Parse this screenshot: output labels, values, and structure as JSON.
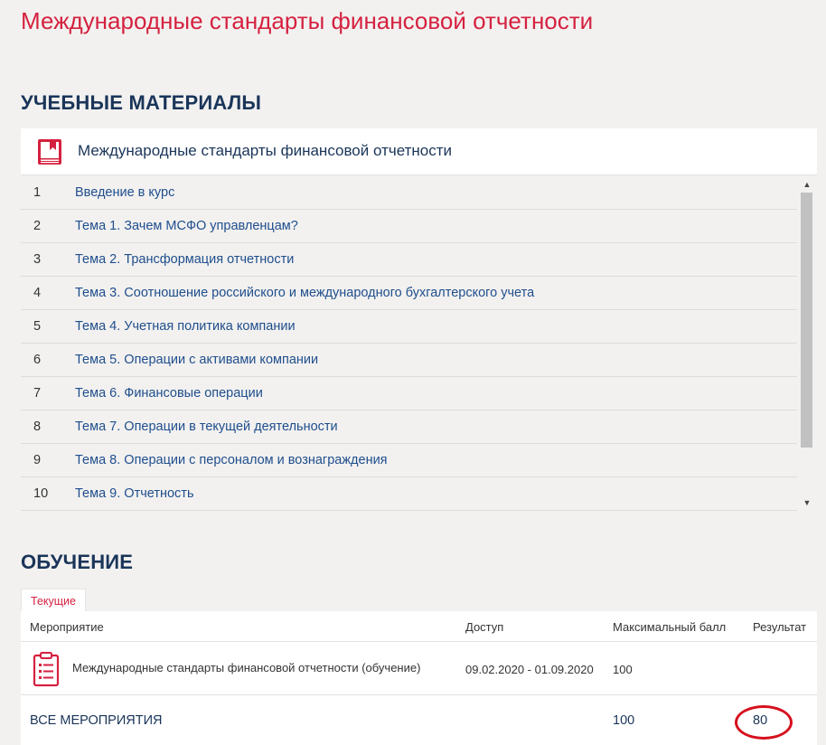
{
  "page": {
    "title": "Международные стандарты финансовой отчетности"
  },
  "materials": {
    "heading": "УЧЕБНЫЕ МАТЕРИАЛЫ",
    "card_title": "Международные стандарты финансовой отчетности",
    "items": [
      {
        "num": "1",
        "label": "Введение в курс"
      },
      {
        "num": "2",
        "label": "Тема 1. Зачем МСФО управленцам?"
      },
      {
        "num": "3",
        "label": "Тема 2. Трансформация отчетности"
      },
      {
        "num": "4",
        "label": "Тема 3. Соотношение российского и международного бухгалтерского учета"
      },
      {
        "num": "5",
        "label": "Тема 4. Учетная политика компании"
      },
      {
        "num": "6",
        "label": "Тема 5. Операции с активами компании"
      },
      {
        "num": "7",
        "label": "Тема 6. Финансовые операции"
      },
      {
        "num": "8",
        "label": "Тема 7. Операции в текущей деятельности"
      },
      {
        "num": "9",
        "label": "Тема 8. Операции с персоналом и вознаграждения"
      },
      {
        "num": "10",
        "label": "Тема 9. Отчетность"
      }
    ]
  },
  "learning": {
    "heading": "ОБУЧЕНИЕ",
    "tab_current": "Текущие",
    "columns": {
      "event": "Мероприятие",
      "access": "Доступ",
      "max_score": "Максимальный балл",
      "result": "Результат"
    },
    "rows": [
      {
        "name": "Международные стандарты финансовой отчетности (обучение)",
        "access": "09.02.2020 - 01.09.2020",
        "max_score": "100",
        "result": ""
      }
    ],
    "total": {
      "label": "ВСЕ МЕРОПРИЯТИЯ",
      "max_score": "100",
      "result": "80"
    }
  },
  "colors": {
    "accent": "#d5213f",
    "heading": "#1a3559",
    "link": "#1f4e8c",
    "highlight": "#d6101d"
  },
  "icons": [
    "book-icon",
    "clipboard-icon",
    "scroll-up-icon",
    "scroll-down-icon"
  ]
}
